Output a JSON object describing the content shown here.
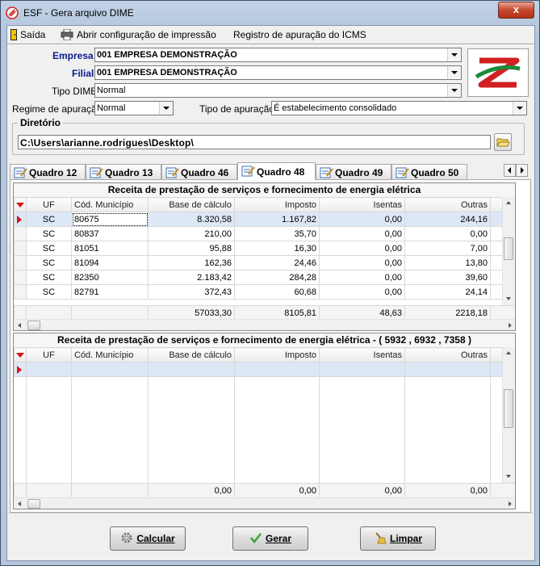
{
  "window": {
    "title": "ESF - Gera arquivo DIME",
    "close_label": "x"
  },
  "menu": [
    {
      "label": "Saída",
      "icon": "exit-door-icon"
    },
    {
      "label": "Abrir configuração de impressão",
      "icon": "printer-icon"
    },
    {
      "label": "Registro de apuração do ICMS"
    }
  ],
  "form": {
    "empresa_label": "Empresa",
    "empresa_value": "001   EMPRESA DEMONSTRAÇÃO",
    "filial_label": "Filial",
    "filial_value": "001   EMPRESA DEMONSTRAÇÃO",
    "tipo_dime_label": "Tipo DIME",
    "tipo_dime_value": "Normal",
    "regime_label": "Regime de apuração",
    "regime_value": "Normal",
    "tipo_apuracao_label": "Tipo de apuração",
    "tipo_apuracao_value": "É estabelecimento consolidado",
    "diretorio_label": "Diretório",
    "diretorio_value": "C:\\Users\\arianne.rodrigues\\Desktop\\"
  },
  "tabs": [
    {
      "label": "Quadro 12",
      "active": false
    },
    {
      "label": "Quadro 13",
      "active": false
    },
    {
      "label": "Quadro 46",
      "active": false
    },
    {
      "label": "Quadro 48",
      "active": true
    },
    {
      "label": "Quadro 49",
      "active": false
    },
    {
      "label": "Quadro 50",
      "active": false
    }
  ],
  "grid1": {
    "caption": "Receita de prestação de serviços e fornecimento de energia elétrica",
    "columns": [
      "UF",
      "Cód. Município",
      "Base de cálculo",
      "Imposto",
      "Isentas",
      "Outras"
    ],
    "rows": [
      [
        "SC",
        "80675",
        "8.320,58",
        "1.167,82",
        "0,00",
        "244,16"
      ],
      [
        "SC",
        "80837",
        "210,00",
        "35,70",
        "0,00",
        "0,00"
      ],
      [
        "SC",
        "81051",
        "95,88",
        "16,30",
        "0,00",
        "7,00"
      ],
      [
        "SC",
        "81094",
        "162,36",
        "24,46",
        "0,00",
        "13,80"
      ],
      [
        "SC",
        "82350",
        "2.183,42",
        "284,28",
        "0,00",
        "39,60"
      ],
      [
        "SC",
        "82791",
        "372,43",
        "60,68",
        "0,00",
        "24,14"
      ]
    ],
    "totals": [
      "",
      "",
      "57033,30",
      "8105,81",
      "48,63",
      "2218,18"
    ]
  },
  "grid2": {
    "caption": "Receita de prestação de serviços e fornecimento de energia elétrica - ( 5932 , 6932 , 7358 )",
    "columns": [
      "UF",
      "Cód. Município",
      "Base de cálculo",
      "Imposto",
      "Isentas",
      "Outras"
    ],
    "totals": [
      "",
      "",
      "0,00",
      "0,00",
      "0,00",
      "0,00"
    ]
  },
  "buttons": {
    "calcular": {
      "label": "Calcular",
      "icon": "gear-icon"
    },
    "gerar": {
      "label": "Gerar",
      "icon": "checkmark-icon"
    },
    "limpar": {
      "label": "Limpar",
      "icon": "broom-icon"
    }
  },
  "colors": {
    "accent_red": "#d11111",
    "label_blue": "#0a1a8c",
    "selected_row": "#dde8f6"
  }
}
